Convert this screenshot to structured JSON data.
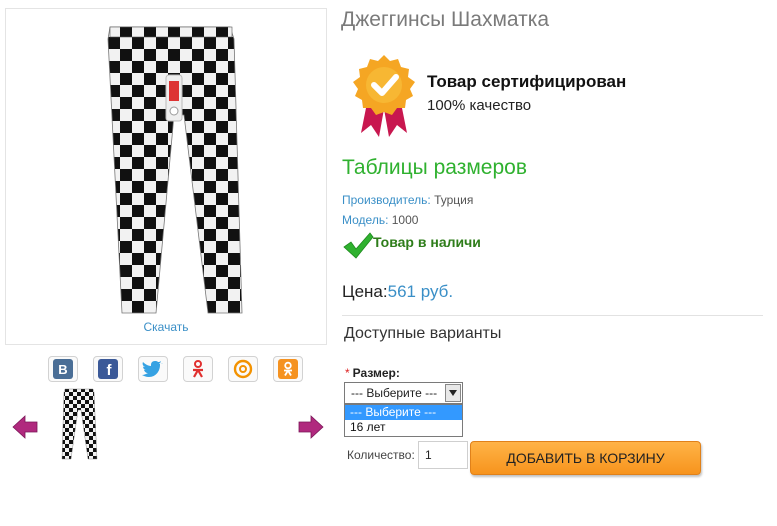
{
  "product": {
    "title": "Джеггинсы Шахматка",
    "download_label": "Скачать"
  },
  "certificate": {
    "title": "Товар сертифицирован",
    "subtitle": "100% качество"
  },
  "size_table_link": "Таблицы размеров",
  "meta": {
    "manufacturer_key": "Производитель:",
    "manufacturer_value": "Турция",
    "model_key": "Модель:",
    "model_value": "1000"
  },
  "stock_status": "Товар в наличи",
  "price": {
    "label": "Цена:",
    "value": "561 руб."
  },
  "variants_heading": "Доступные варианты",
  "size_option": {
    "required_mark": "*",
    "label": "Размер:",
    "selected": "--- Выберите ---",
    "options": [
      "--- Выберите ---",
      "16 лет"
    ]
  },
  "quantity": {
    "label": "Количество:",
    "value": "1"
  },
  "add_to_cart_label": "ДОБАВИТЬ В КОРЗИНУ",
  "share_icons": [
    "vk-icon",
    "facebook-icon",
    "twitter-icon",
    "odnoklassniki-icon",
    "mail-ru-icon",
    "ok-icon"
  ],
  "colors": {
    "accent_blue": "#3a8fc7",
    "green": "#2fb12f",
    "orange_button": "#f7941d",
    "nav_arrow": "#b0297e"
  }
}
